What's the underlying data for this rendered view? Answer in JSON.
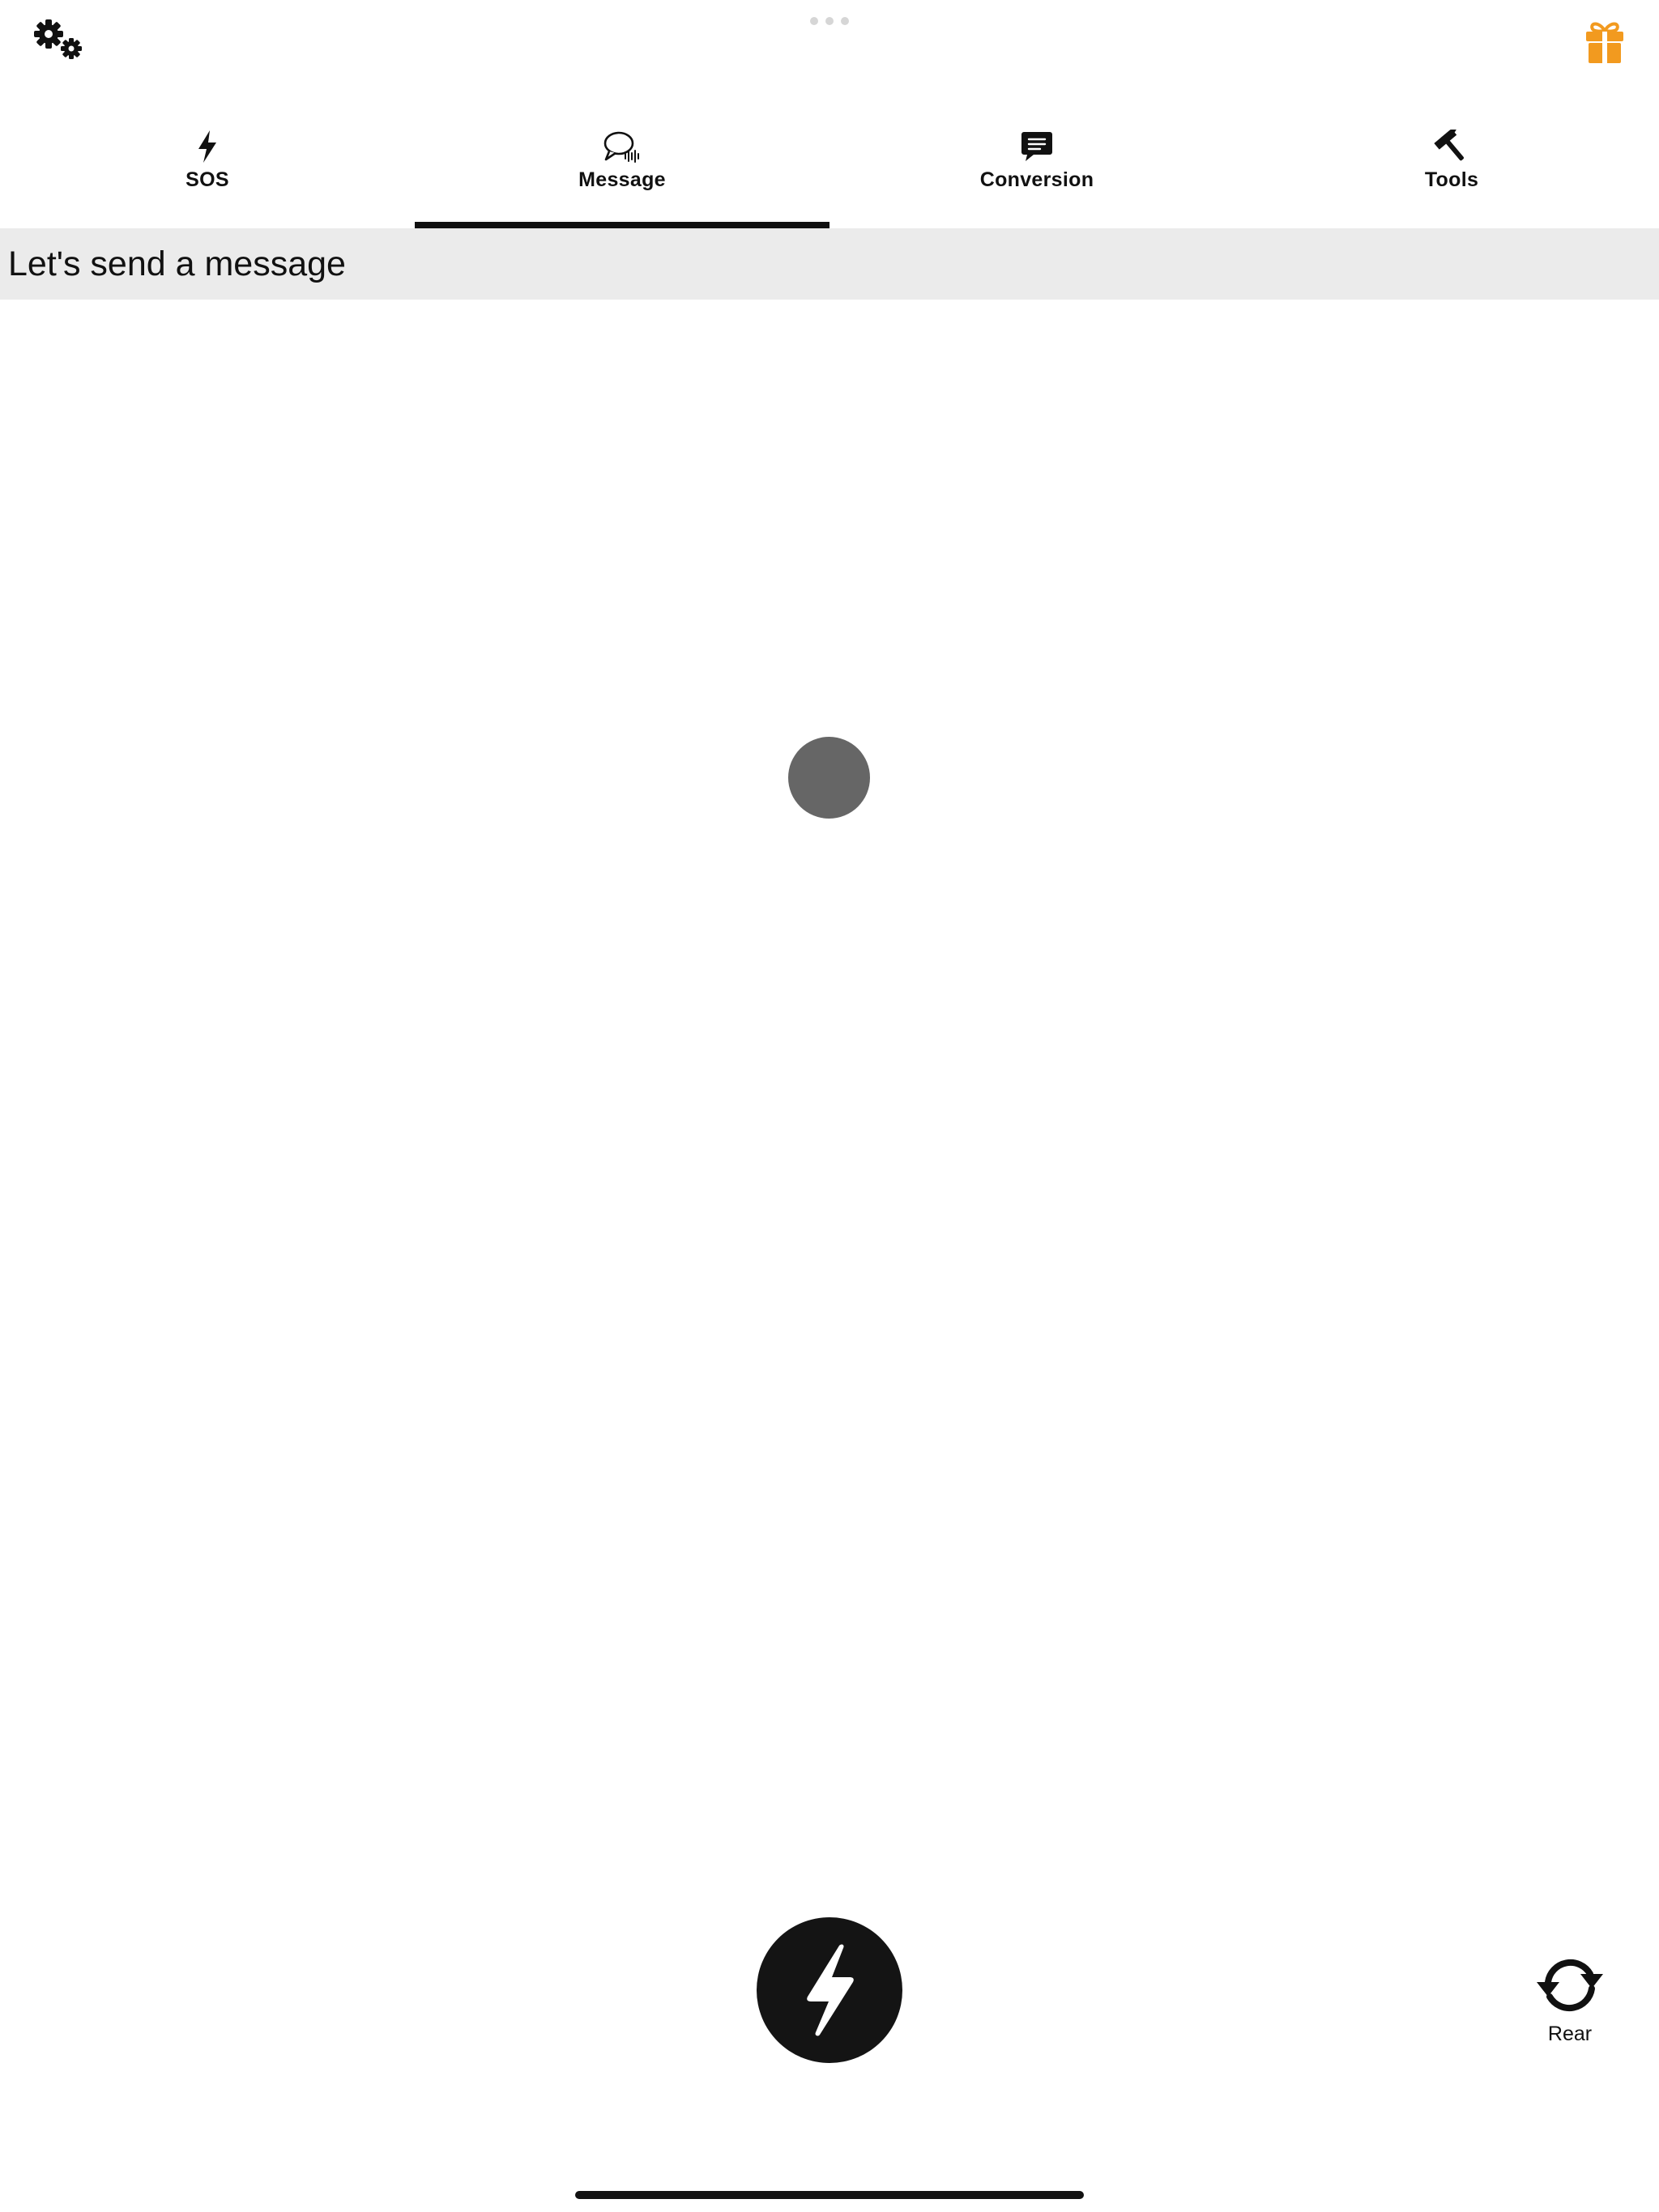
{
  "top_bar": {
    "settings_icon": "gears-icon",
    "gift_icon": "gift-icon",
    "gift_color": "#F29A1F",
    "more_icon": "more-dots-icon"
  },
  "tabs": [
    {
      "label": "SOS",
      "icon": "bolt-icon",
      "active": false
    },
    {
      "label": "Message",
      "icon": "speech-bubble-icon",
      "active": true
    },
    {
      "label": "Conversion",
      "icon": "chat-bubble-icon",
      "active": false
    },
    {
      "label": "Tools",
      "icon": "hammer-icon",
      "active": false
    }
  ],
  "header": {
    "title": "Let's send a message"
  },
  "flash_button": {
    "icon": "bolt-icon"
  },
  "camera_switch": {
    "icon": "rotate-camera-icon",
    "label": "Rear"
  },
  "colors": {
    "accent": "#111111",
    "header_background": "#EBEBEB",
    "indicator": "#666666"
  }
}
